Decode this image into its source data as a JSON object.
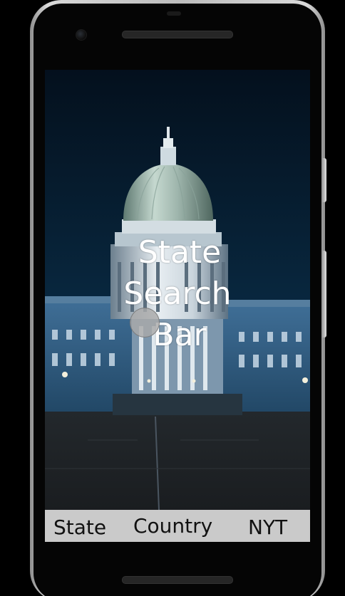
{
  "hero": {
    "title_lines": [
      "State",
      "Search",
      "Bar"
    ]
  },
  "bottom_bar": {
    "items": [
      {
        "label": "State"
      },
      {
        "label": "Country"
      },
      {
        "label": "NYT"
      }
    ]
  },
  "colors": {
    "bottom_bar_bg": "#cacaca",
    "title_text": "#ffffff",
    "sky_top": "#031524"
  },
  "icons": {
    "camera": "front-camera-icon",
    "touch": "touch-indicator-icon"
  }
}
